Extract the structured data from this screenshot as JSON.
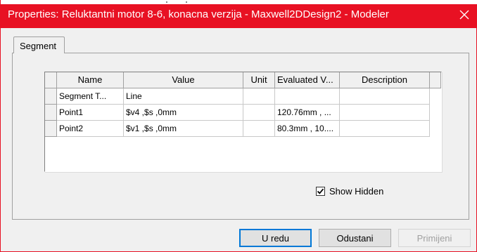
{
  "window": {
    "title": "Properties: Reluktantni motor 8-6, konacna verzija - Maxwell2DDesign2 - Modeler",
    "close_icon": "close-icon",
    "accent_color": "#e81123"
  },
  "tabs": [
    {
      "label": "Segment",
      "selected": true
    }
  ],
  "table": {
    "columns": [
      "Name",
      "Value",
      "Unit",
      "Evaluated V...",
      "Description"
    ],
    "rows": [
      {
        "name": "Segment T...",
        "value": "Line",
        "unit": "",
        "evaluated": "",
        "description": ""
      },
      {
        "name": "Point1",
        "value": "$v4 ,$s ,0mm",
        "unit": "",
        "evaluated": "120.76mm , ...",
        "description": ""
      },
      {
        "name": "Point2",
        "value": "$v1 ,$s ,0mm",
        "unit": "",
        "evaluated": "80.3mm , 10....",
        "description": ""
      }
    ]
  },
  "show_hidden": {
    "label": "Show Hidden",
    "checked": true
  },
  "buttons": {
    "ok": "U redu",
    "cancel": "Odustani",
    "apply": "Primijeni"
  }
}
